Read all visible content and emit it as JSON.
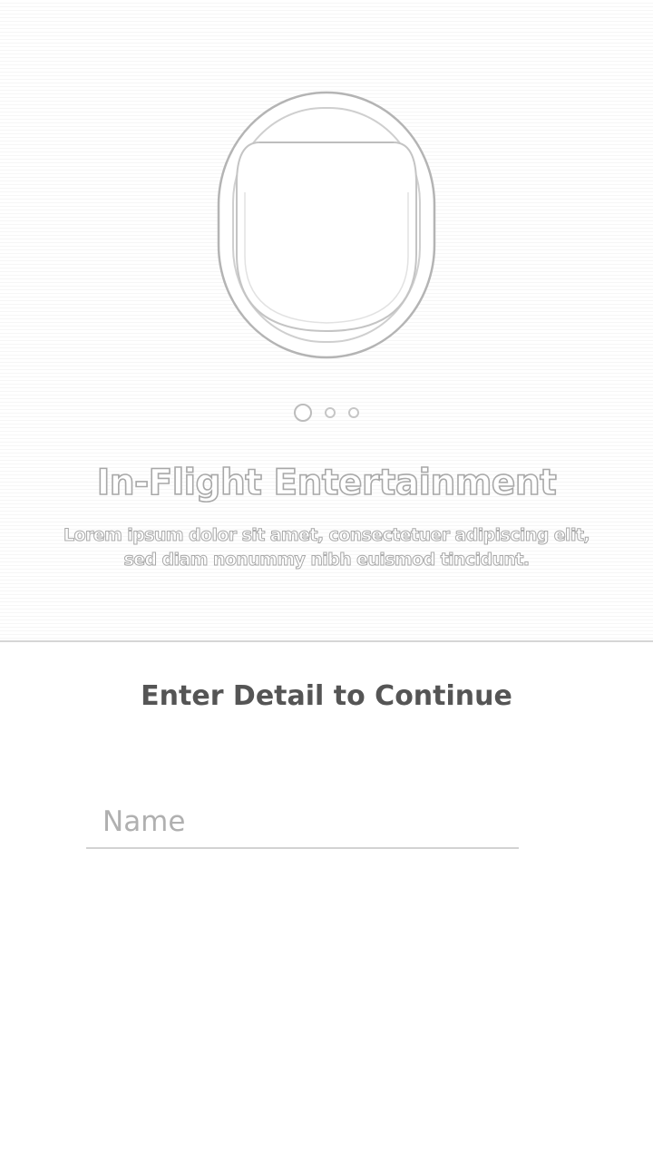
{
  "onboarding": {
    "title": "In-Flight Entertainment",
    "description": "Lorem ipsum dolor sit amet, consectetuer adipiscing elit, sed diam nonummy nibh euismod tincidunt.",
    "pager": {
      "pages": 3,
      "active_index": 0
    },
    "illustration_icon": "airplane-window-icon"
  },
  "form": {
    "heading": "Enter Detail to Continue",
    "name_field": {
      "placeholder": "Name",
      "value": ""
    }
  },
  "colors": {
    "text_primary": "#555555",
    "placeholder": "#b0b0b0",
    "outline": "#a8a8a8",
    "divider": "#d6d6d6"
  }
}
